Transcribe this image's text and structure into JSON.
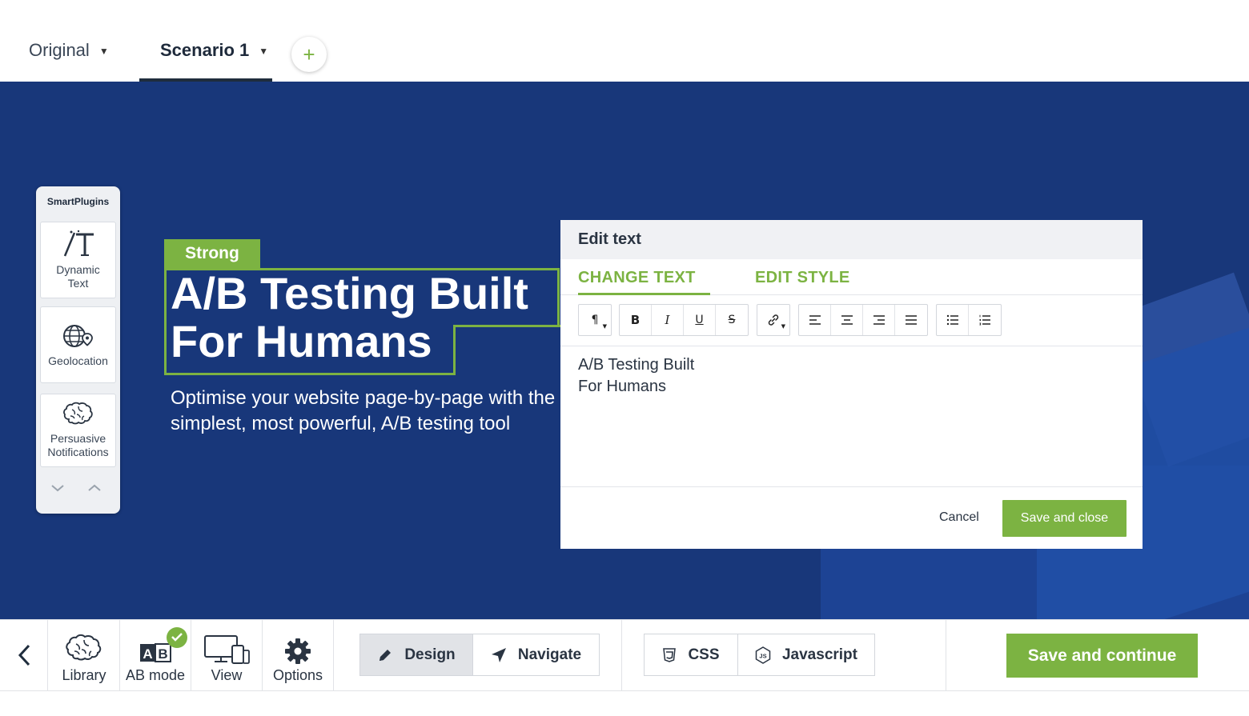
{
  "scenario_tabs": [
    {
      "label": "Original",
      "active": false
    },
    {
      "label": "Scenario 1",
      "active": true
    }
  ],
  "add_scenario": {
    "label": "+"
  },
  "smart_plugins": {
    "title": "SmartPlugins",
    "items": [
      {
        "label": "Dynamic Text",
        "lines": [
          "Dynamic",
          "Text"
        ],
        "icon": "dynamic-text-icon"
      },
      {
        "label": "Geolocation",
        "lines": [
          "Geolocation"
        ],
        "icon": "globe-location-icon"
      },
      {
        "label": "Persuasive Notifications",
        "lines": [
          "Persuasive",
          "Notifications"
        ],
        "icon": "brain-icon"
      }
    ]
  },
  "hero": {
    "tag": "Strong",
    "title_lines": [
      "A/B Testing Built",
      "For Humans"
    ],
    "subtitle_lines": [
      "Optimise your website page-by-page with the",
      "simplest, most powerful, A/B testing tool"
    ]
  },
  "edit_modal": {
    "title": "Edit text",
    "tabs": [
      {
        "label": "CHANGE TEXT",
        "active": true
      },
      {
        "label": "EDIT STYLE",
        "active": false
      }
    ],
    "toolbar": {
      "paragraph": "¶",
      "bold": "B",
      "italic": "I",
      "underline": "U",
      "strike": "S"
    },
    "content_lines": [
      "A/B Testing Built",
      "For Humans"
    ],
    "cancel_label": "Cancel",
    "save_label": "Save and close"
  },
  "bottom_bar": {
    "library": "Library",
    "ab_mode": "AB mode",
    "view": "View",
    "options": "Options",
    "design": "Design",
    "navigate": "Navigate",
    "css": "CSS",
    "javascript": "Javascript",
    "save_continue": "Save and continue"
  },
  "colors": {
    "accent": "#7cb342",
    "stage_blue": "#18377a",
    "text_dark": "#1f2d3d"
  }
}
